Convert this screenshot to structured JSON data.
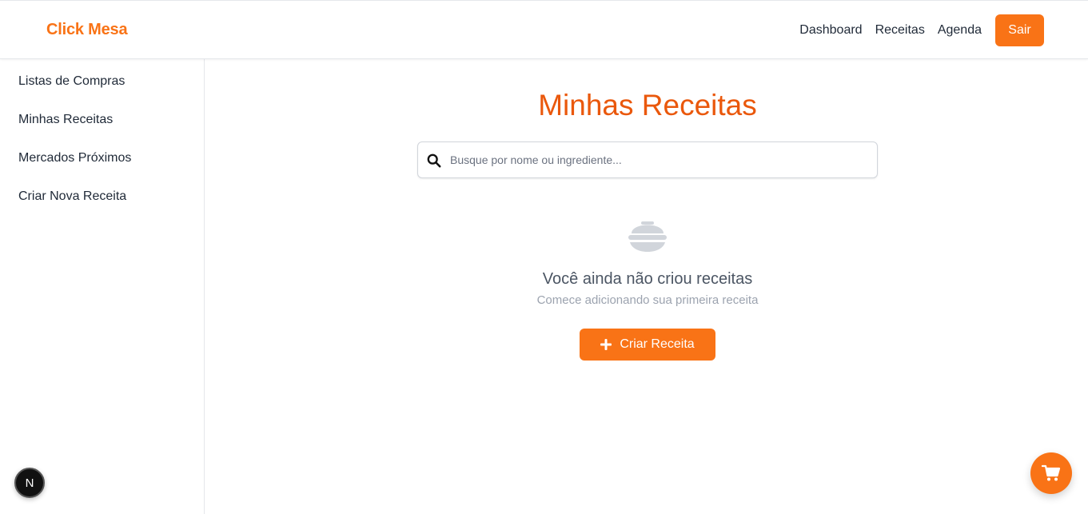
{
  "header": {
    "logo": "Click Mesa",
    "nav": [
      "Dashboard",
      "Receitas",
      "Agenda"
    ],
    "logout_label": "Sair"
  },
  "sidebar": {
    "items": [
      {
        "label": "Listas de Compras"
      },
      {
        "label": "Minhas Receitas"
      },
      {
        "label": "Mercados Próximos"
      },
      {
        "label": "Criar Nova Receita"
      }
    ]
  },
  "main": {
    "title": "Minhas Receitas",
    "search": {
      "placeholder": "Busque por nome ou ingrediente...",
      "value": "",
      "icon": "search-icon"
    },
    "empty_state": {
      "icon": "bowl-icon",
      "title": "Você ainda não criou receitas",
      "subtitle": "Comece adicionando sua primeira receita",
      "button_label": "Criar Receita"
    }
  },
  "floating": {
    "cart_icon": "cart-icon",
    "dev_badge_letter": "N"
  },
  "colors": {
    "accent": "#f97316",
    "title": "#ea580c",
    "muted_text": "#9ca3af",
    "empty_icon": "#d1d5db"
  }
}
